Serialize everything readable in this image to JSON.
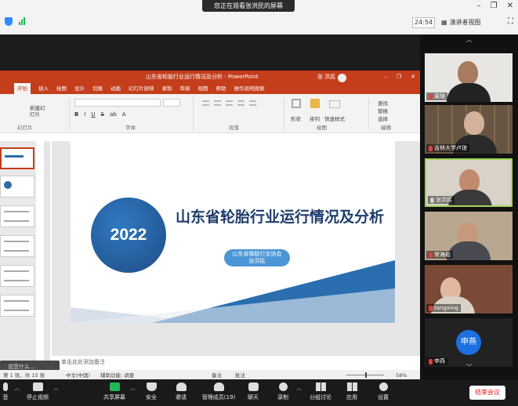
{
  "zoom": {
    "banner": "您正在观看张洪民的屏幕",
    "timer": "24:54",
    "view_label": "演讲者视图"
  },
  "ppt": {
    "window_title": "山东省轮胎行业运行情况及分析 - PowerPoint",
    "user": "张 洪民",
    "tabs": [
      "开始",
      "插入",
      "绘图",
      "设计",
      "切换",
      "动画",
      "幻灯片放映",
      "录制",
      "审阅",
      "视图",
      "帮助",
      "操作说明搜索"
    ],
    "ribbon": {
      "new_slide": "新建幻灯片",
      "group_slides": "幻灯片",
      "group_font": "字体",
      "group_paragraph": "段落",
      "group_drawing": "绘图",
      "group_editing": "编辑",
      "shapes": "形状",
      "arrange": "排列",
      "quick_styles": "快速样式",
      "find": "查找",
      "replace": "替换",
      "select": "选择",
      "format_buttons": [
        "B",
        "I",
        "U",
        "S",
        "ab",
        "A"
      ]
    },
    "slide": {
      "year": "2022",
      "title": "山东省轮胎行业运行情况及分析",
      "org": "山东省橡胶行业协会",
      "presenter": "张洪民"
    },
    "notes_placeholder": "单击此处添加备注",
    "status": {
      "slide_count": "第 1 张，共 15 张",
      "language": "中文(中国)",
      "accessibility": "辅助功能: 调查",
      "notes": "备注",
      "comments": "批注",
      "zoom": "58%"
    },
    "caption_overlay": "说您什么..."
  },
  "participants": [
    {
      "name": "周琦"
    },
    {
      "name": "吉林大学卢琼"
    },
    {
      "name": "张洪民"
    },
    {
      "name": "常海崧"
    },
    {
      "name": "tangxing"
    },
    {
      "name": "申燕",
      "avatar_text": "申燕"
    }
  ],
  "toolbar": {
    "audio": "音",
    "stop_video": "停止视频",
    "share_screen": "共享屏幕",
    "security": "安全",
    "invite": "邀请",
    "manage_participants": "管理成员(19)",
    "chat": "聊天",
    "record": "录制",
    "breakout": "分组讨论",
    "apps": "应用",
    "settings": "设置",
    "end_meeting": "结束会议"
  }
}
